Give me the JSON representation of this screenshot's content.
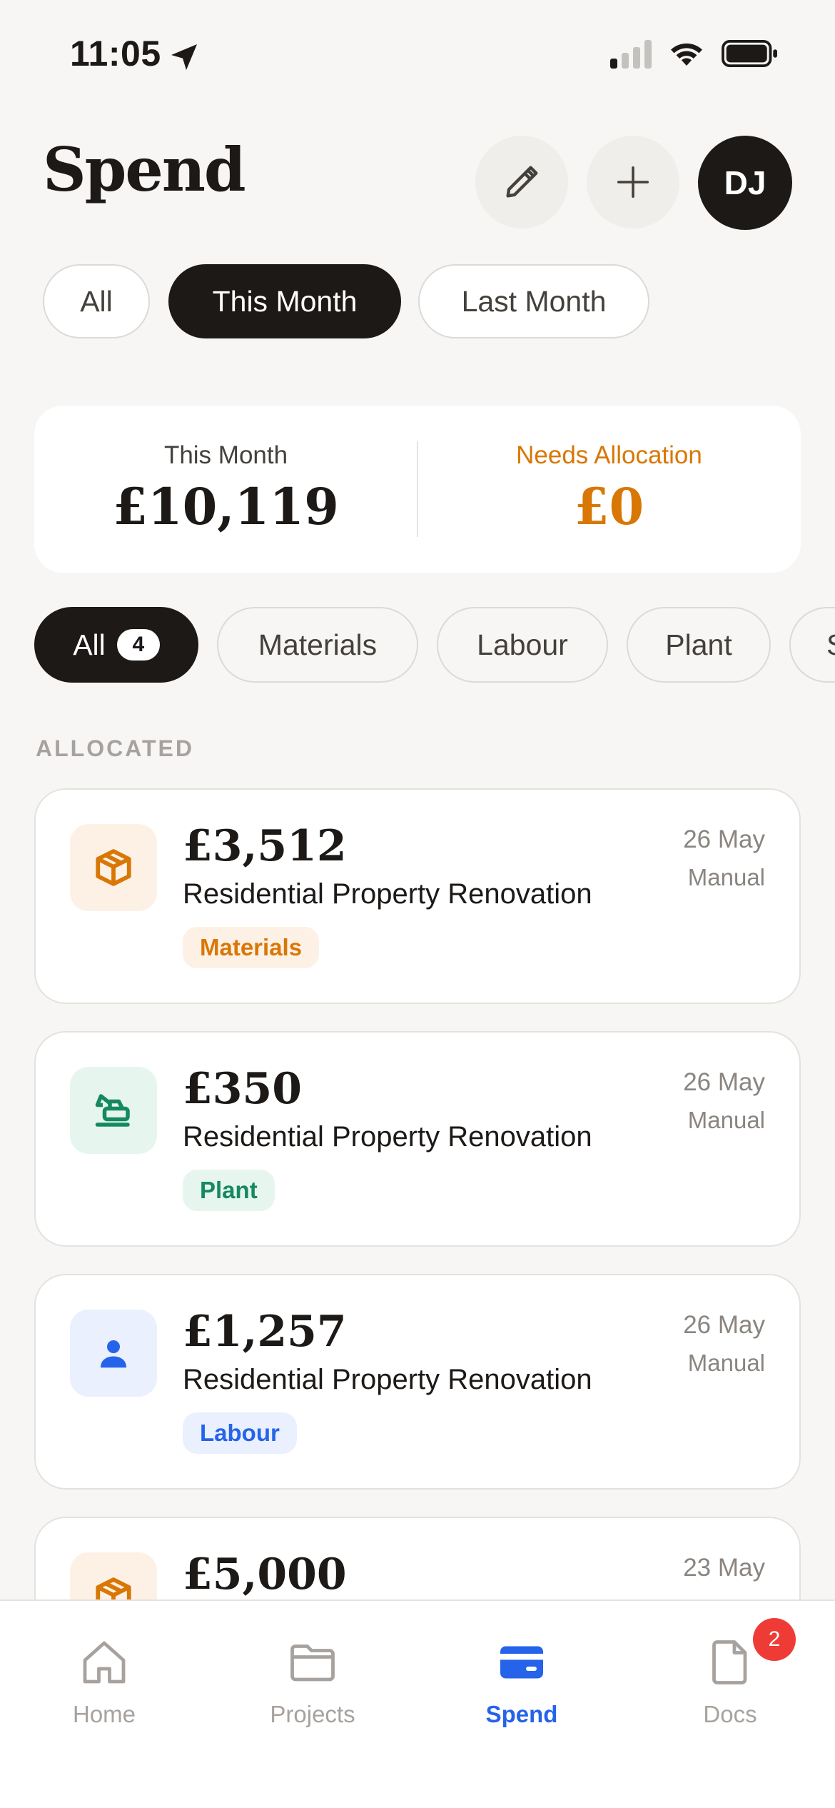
{
  "status_bar": {
    "time": "11:05"
  },
  "header": {
    "title": "Spend",
    "avatar_initials": "DJ"
  },
  "period_filters": [
    {
      "label": "All",
      "active": false
    },
    {
      "label": "This Month",
      "active": true
    },
    {
      "label": "Last Month",
      "active": false
    }
  ],
  "summary": {
    "left_label": "This Month",
    "left_value": "£10,119",
    "right_label": "Needs Allocation",
    "right_value": "£0"
  },
  "category_filters": [
    {
      "label": "All",
      "count": "4",
      "active": true
    },
    {
      "label": "Materials"
    },
    {
      "label": "Labour"
    },
    {
      "label": "Plant"
    },
    {
      "label": "S"
    }
  ],
  "section_label": "ALLOCATED",
  "transactions": [
    {
      "amount": "£3,512",
      "project": "Residential Property Renovation",
      "category": "Materials",
      "date": "26 May",
      "source": "Manual",
      "icon": "materials-box-icon"
    },
    {
      "amount": "£350",
      "project": "Residential Property Renovation",
      "category": "Plant",
      "date": "26 May",
      "source": "Manual",
      "icon": "excavator-icon"
    },
    {
      "amount": "£1,257",
      "project": "Residential Property Renovation",
      "category": "Labour",
      "date": "26 May",
      "source": "Manual",
      "icon": "person-icon"
    },
    {
      "amount": "£5,000",
      "date": "23 May",
      "icon": "materials-box-icon"
    }
  ],
  "tab_bar": {
    "tabs": [
      {
        "label": "Home",
        "icon": "home-icon"
      },
      {
        "label": "Projects",
        "icon": "folder-icon"
      },
      {
        "label": "Spend",
        "icon": "card-icon",
        "active": true
      },
      {
        "label": "Docs",
        "icon": "document-icon",
        "badge": "2"
      }
    ]
  },
  "colors": {
    "accent_blue": "#2563eb",
    "needs_allocation_orange": "#d97706",
    "materials_tag_bg": "#fdf1e6",
    "materials_tag_text": "#d97706",
    "plant_tag_bg": "#e7f5ef",
    "plant_tag_text": "#15895f",
    "labour_tag_bg": "#eaf0fd",
    "labour_tag_text": "#2563eb",
    "badge_red": "#ef3b36"
  }
}
